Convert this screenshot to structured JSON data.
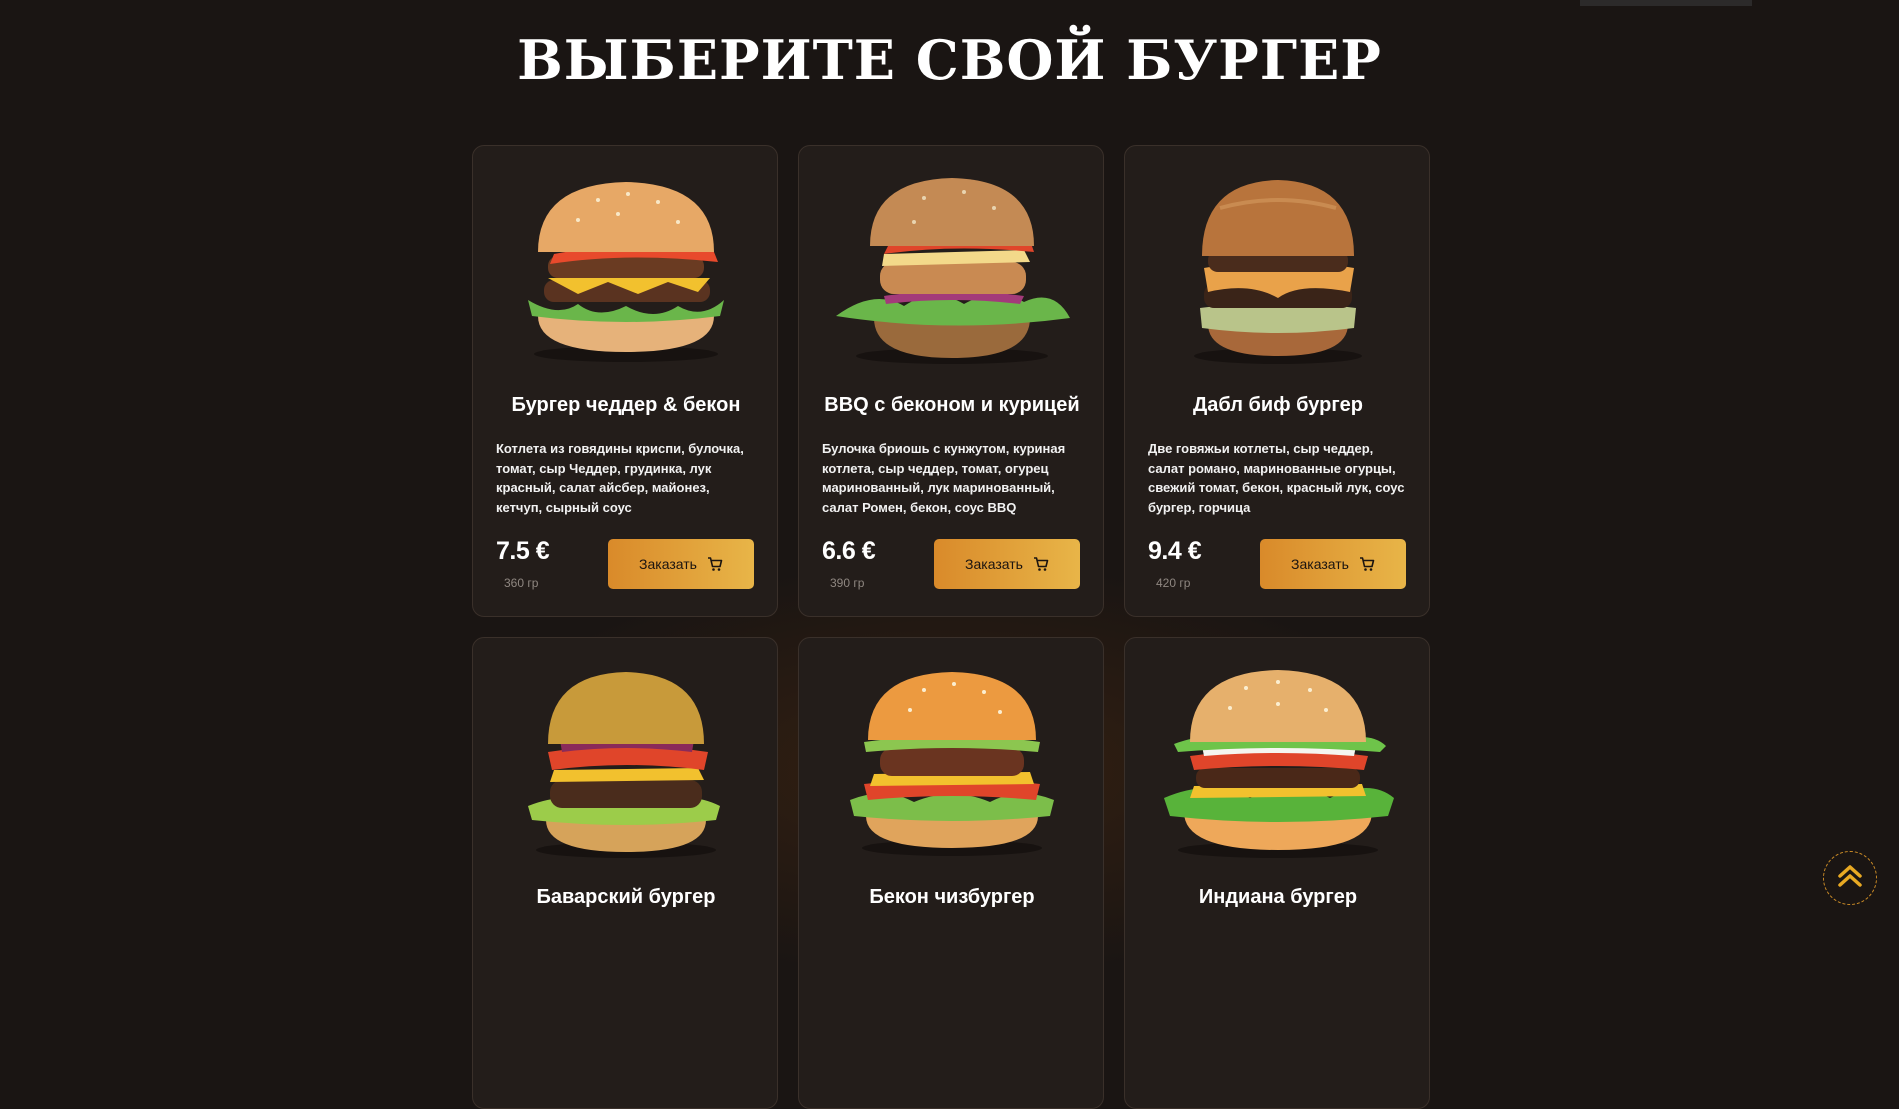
{
  "section": {
    "title": "ВЫБЕРИТЕ СВОЙ БУРГЕР"
  },
  "cards": [
    {
      "title": "Бургер чеддер & бекон",
      "desc": "Котлета из говядины криспи, булочка, томат, сыр Чеддер, грудинка, лук красный, салат айсбер, майонез, кетчуп, сырный соус",
      "price": "7.5 €",
      "weight": "360 гр",
      "button": "Заказать",
      "icon": "burger-image"
    },
    {
      "title": "BBQ с беконом и курицей",
      "desc": "Булочка бриошь с кунжутом, куриная котлета, сыр чеддер, томат, огурец маринованный, лук маринованный, салат Ромен, бекон, соус BBQ",
      "price": "6.6 €",
      "weight": "390 гр",
      "button": "Заказать",
      "icon": "burger-image"
    },
    {
      "title": "Дабл биф бургер",
      "desc": "Две говяжьи котлеты, сыр чеддер, салат романо, маринованные огурцы, свежий томат, бекон, красный лук, соус бургер, горчица",
      "price": "9.4 €",
      "weight": "420 гр",
      "button": "Заказать",
      "icon": "burger-image"
    },
    {
      "title": "Баварский бургер",
      "icon": "burger-image"
    },
    {
      "title": "Бекон чизбургер",
      "icon": "burger-image"
    },
    {
      "title": "Индиана бургер",
      "icon": "burger-image"
    }
  ],
  "icons": {
    "cart": "cart-icon",
    "scroll_top": "double-chevron-up-icon"
  },
  "colors": {
    "background": "#1a1513",
    "card": "#231d1a",
    "accent_start": "#d98a2a",
    "accent_end": "#e8b548",
    "muted": "#8f8781"
  }
}
